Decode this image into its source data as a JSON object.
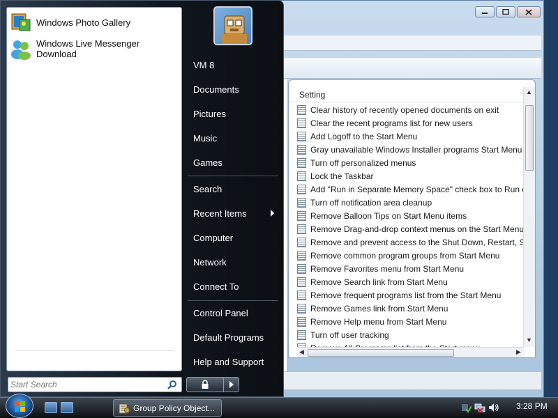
{
  "start_menu": {
    "pinned_programs": [
      {
        "label": "Windows Photo Gallery",
        "icon": "photo-gallery-icon"
      },
      {
        "label": "Windows Live Messenger Download",
        "icon": "messenger-icon"
      }
    ],
    "search_placeholder": "Start Search",
    "right_items": [
      {
        "label": "VM 8"
      },
      {
        "label": "Documents"
      },
      {
        "label": "Pictures"
      },
      {
        "label": "Music"
      },
      {
        "label": "Games"
      },
      {
        "label": "Search"
      },
      {
        "label": "Recent Items",
        "submenu": true
      },
      {
        "label": "Computer"
      },
      {
        "label": "Network"
      },
      {
        "label": "Connect To"
      },
      {
        "label": "Control Panel"
      },
      {
        "label": "Default Programs"
      },
      {
        "label": "Help and Support"
      }
    ]
  },
  "settings_list": {
    "column_header": "Setting",
    "rows": [
      "Clear history of recently opened documents on exit",
      "Clear the recent programs list for new users",
      "Add Logoff to the Start Menu",
      "Gray unavailable Windows Installer programs Start Menu s",
      "Turn off personalized menus",
      "Lock the Taskbar",
      "Add \"Run in Separate Memory Space\" check box to Run di",
      "Turn off notification area cleanup",
      "Remove Balloon Tips on Start Menu items",
      "Remove Drag-and-drop context menus on the Start Menu",
      "Remove and prevent access to the Shut Down, Restart, Sle",
      "Remove common program groups from Start Menu",
      "Remove Favorites menu from Start Menu",
      "Remove Search link from Start Menu",
      "Remove frequent programs list from the Start Menu",
      "Remove Games link from Start Menu",
      "Remove Help menu from Start Menu",
      "Turn off user tracking",
      "Remove All Programs list from the Start menu"
    ]
  },
  "taskbar": {
    "task_button_label": "Group Policy Object...",
    "clock": "3:28 PM"
  },
  "colors": {
    "start_menu_bg": "#10161d",
    "taskbar_bg": "#0c0f13",
    "orb": "#2660a6"
  }
}
